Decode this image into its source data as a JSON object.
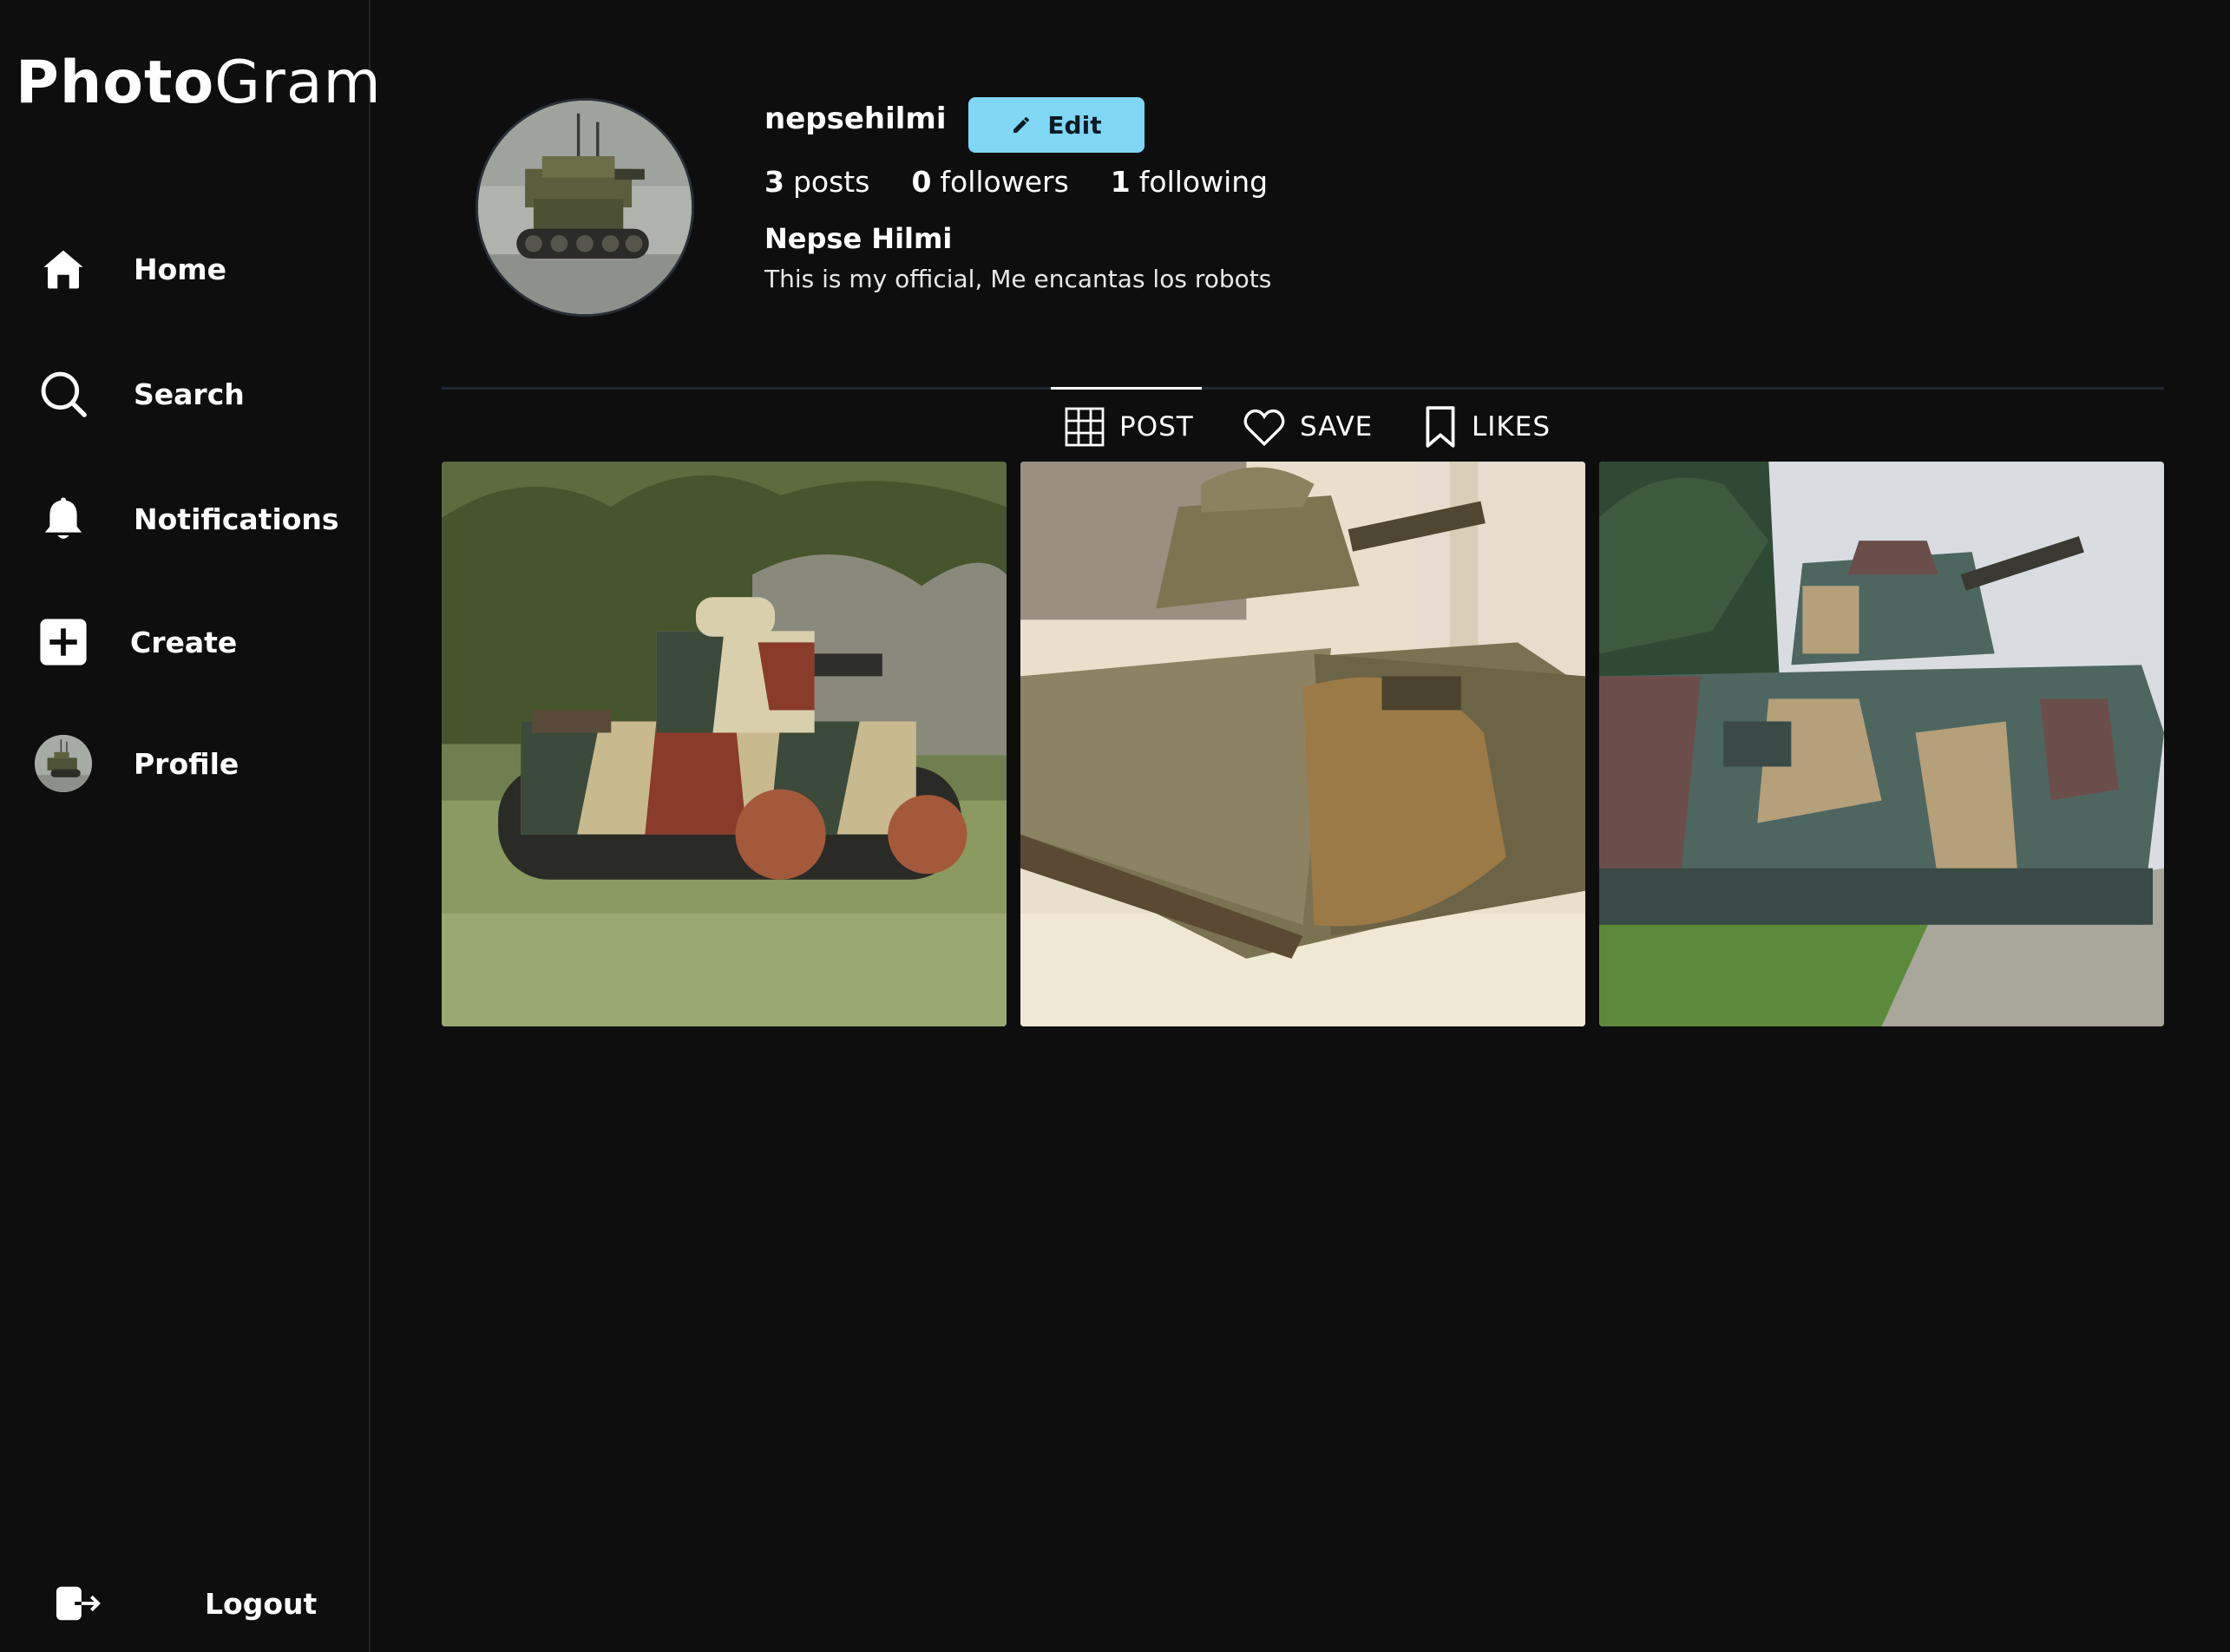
{
  "app": {
    "logo_bold": "Photo",
    "logo_light": "Gram"
  },
  "sidebar": {
    "items": [
      {
        "label": "Home",
        "icon": "home-icon"
      },
      {
        "label": "Search",
        "icon": "search-icon"
      },
      {
        "label": "Notifications",
        "icon": "bell-icon"
      },
      {
        "label": "Create",
        "icon": "plus-square-icon"
      },
      {
        "label": "Profile",
        "icon": "avatar"
      }
    ],
    "logout_label": "Logout",
    "logout_icon": "logout-icon"
  },
  "profile": {
    "username": "nepsehilmi",
    "edit_label": "Edit",
    "posts_count": "3",
    "posts_label": "posts",
    "followers_count": "0",
    "followers_label": "followers",
    "following_count": "1",
    "following_label": "following",
    "full_name": "Nepse Hilmi",
    "bio": "This is my official, Me encantas los robots"
  },
  "tabs": [
    {
      "label": "POST",
      "icon": "grid-icon",
      "active": true
    },
    {
      "label": "SAVE",
      "icon": "heart-icon",
      "active": false
    },
    {
      "label": "LIKES",
      "icon": "bookmark-icon",
      "active": false
    }
  ],
  "colors": {
    "background": "#0e0e0f",
    "accent": "#7fd7f5"
  }
}
